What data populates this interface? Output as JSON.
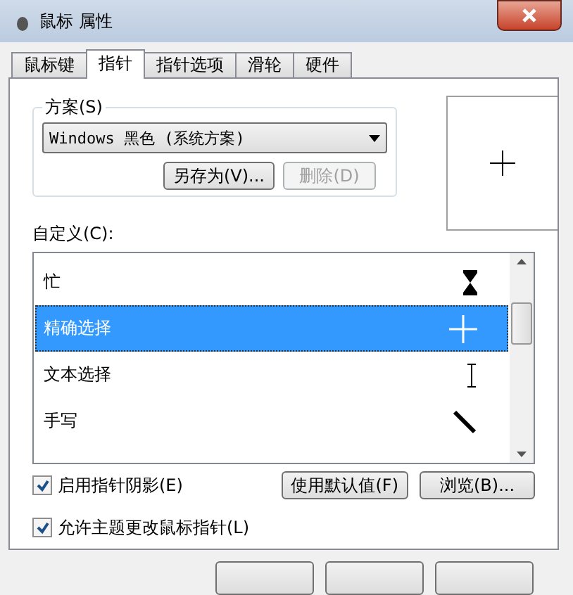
{
  "window": {
    "title": "鼠标 属性"
  },
  "tabs": [
    {
      "label": "鼠标键",
      "selected": false
    },
    {
      "label": "指针",
      "selected": true
    },
    {
      "label": "指针选项",
      "selected": false
    },
    {
      "label": "滑轮",
      "selected": false
    },
    {
      "label": "硬件",
      "selected": false
    }
  ],
  "scheme": {
    "label": "方案(S)",
    "value": "Windows 黑色 (系统方案)",
    "buttons": [
      {
        "label": "另存为(V)...",
        "disabled": false
      },
      {
        "label": "删除(D)",
        "disabled": true
      }
    ]
  },
  "customize": {
    "label": "自定义(C):",
    "items": [
      {
        "name": "忙",
        "kind": "hourglass",
        "selected": false
      },
      {
        "name": "精确选择",
        "kind": "crosshair",
        "selected": true
      },
      {
        "name": "文本选择",
        "kind": "ibeam",
        "selected": false
      },
      {
        "name": "手写",
        "kind": "pen",
        "selected": false
      }
    ]
  },
  "options": [
    {
      "label": "启用指针阴影(E)",
      "checked": true
    },
    {
      "label": "允许主题更改鼠标指针(L)",
      "checked": true
    }
  ],
  "list_buttons": [
    "使用默认值(F)",
    "浏览(B)..."
  ]
}
